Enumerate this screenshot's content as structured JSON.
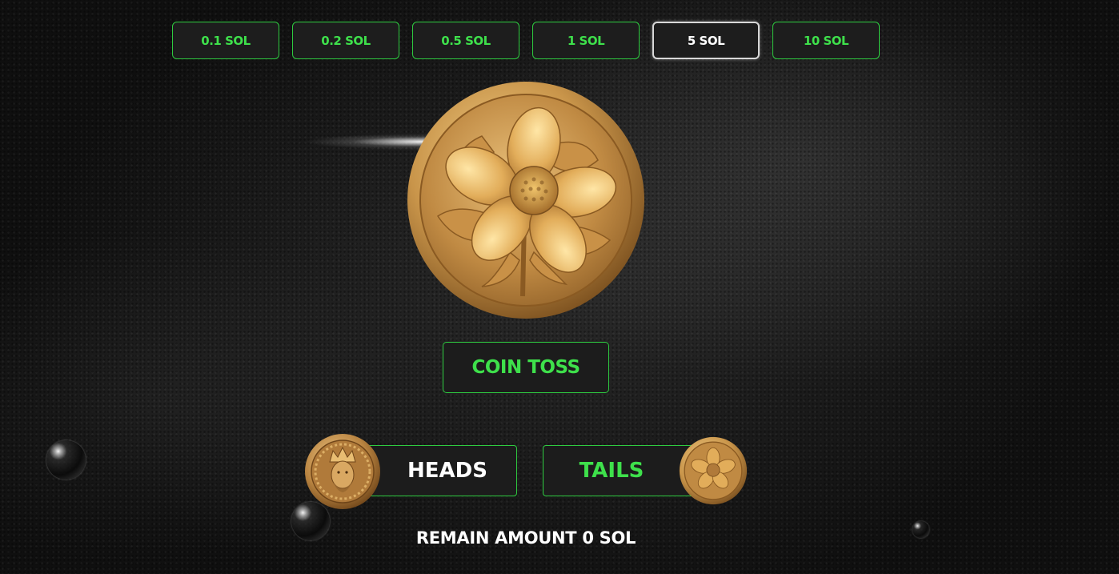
{
  "amounts": {
    "options": [
      "0.1 SOL",
      "0.2 SOL",
      "0.5 SOL",
      "1 SOL",
      "5 SOL",
      "10 SOL"
    ],
    "selected": "5 SOL"
  },
  "main_coin": {
    "face": "flower-coin-icon"
  },
  "toss_button": {
    "label": "COIN TOSS"
  },
  "choices": {
    "heads": {
      "label": "HEADS",
      "icon": "king-coin-icon"
    },
    "tails": {
      "label": "TAILS",
      "icon": "flower-coin-icon"
    }
  },
  "status": {
    "remain_text": "REMAIN AMOUNT 0 SOL"
  },
  "colors": {
    "accent_green": "#3ee04b",
    "selected_border": "#d8d8d8",
    "button_bg": "#1c1c1c",
    "coin_gold": "#c9954a"
  }
}
